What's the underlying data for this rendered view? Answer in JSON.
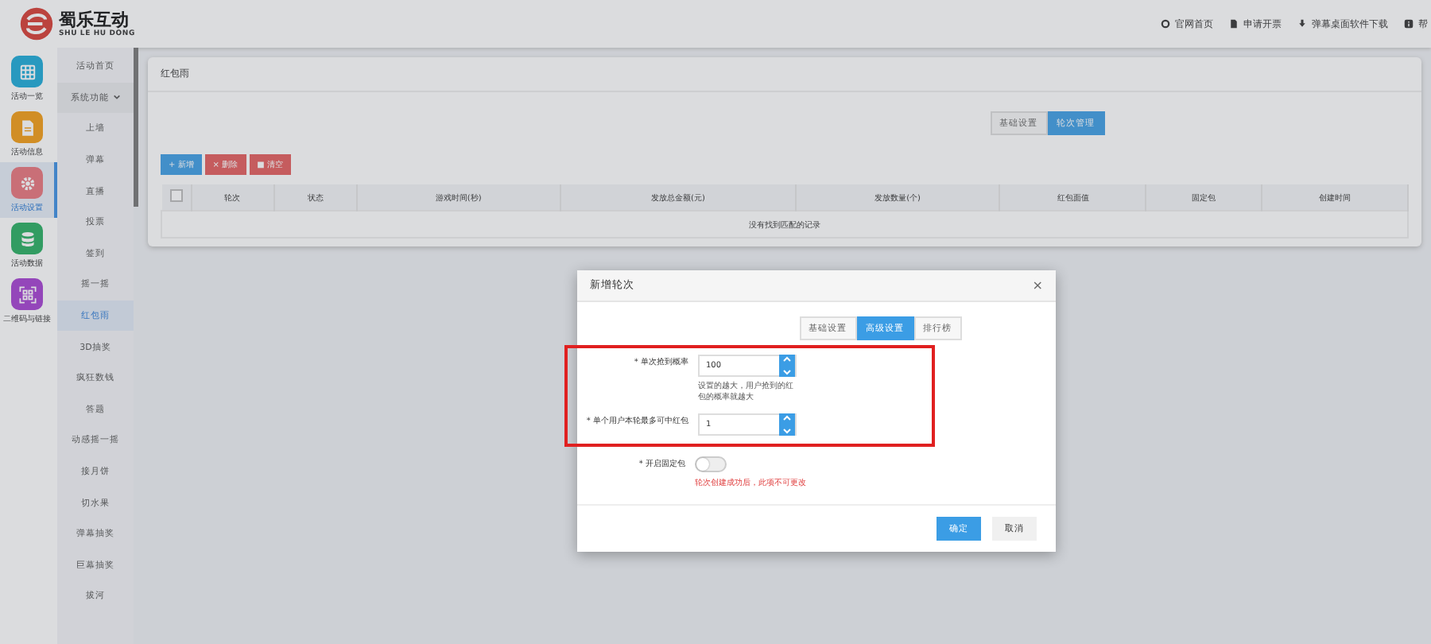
{
  "logo": {
    "name": "蜀乐互动",
    "subtitle": "SHU LE HU DONG"
  },
  "top_links": [
    {
      "label": "官网首页"
    },
    {
      "label": "申请开票"
    },
    {
      "label": "弹幕桌面软件下载"
    },
    {
      "label": "帮"
    }
  ],
  "nav": [
    {
      "label": "活动一览",
      "selected": false
    },
    {
      "label": "活动信息",
      "selected": false
    },
    {
      "label": "活动设置",
      "selected": true
    },
    {
      "label": "活动数据",
      "selected": false
    },
    {
      "label": "二维码与链接",
      "selected": false
    }
  ],
  "subnav": [
    {
      "label": "活动首页",
      "selected": false,
      "expandable": false
    },
    {
      "label": "系统功能",
      "selected": false,
      "expandable": true
    },
    {
      "label": "上墙",
      "selected": false,
      "expandable": false
    },
    {
      "label": "弹幕",
      "selected": false,
      "expandable": false
    },
    {
      "label": "直播",
      "selected": false,
      "expandable": false
    },
    {
      "label": "投票",
      "selected": false,
      "expandable": false
    },
    {
      "label": "签到",
      "selected": false,
      "expandable": false
    },
    {
      "label": "摇一摇",
      "selected": false,
      "expandable": false
    },
    {
      "label": "红包雨",
      "selected": true,
      "expandable": false
    },
    {
      "label": "3D抽奖",
      "selected": false,
      "expandable": false
    },
    {
      "label": "疯狂数钱",
      "selected": false,
      "expandable": false
    },
    {
      "label": "答题",
      "selected": false,
      "expandable": false
    },
    {
      "label": "动感摇一摇",
      "selected": false,
      "expandable": false
    },
    {
      "label": "接月饼",
      "selected": false,
      "expandable": false
    },
    {
      "label": "切水果",
      "selected": false,
      "expandable": false
    },
    {
      "label": "弹幕抽奖",
      "selected": false,
      "expandable": false
    },
    {
      "label": "巨幕抽奖",
      "selected": false,
      "expandable": false
    },
    {
      "label": "拔河",
      "selected": false,
      "expandable": false
    }
  ],
  "panel": {
    "title": "红包雨",
    "tabs": [
      {
        "label": "基础设置",
        "selected": false
      },
      {
        "label": "轮次管理",
        "selected": true
      }
    ],
    "actions": [
      {
        "label": "新增",
        "kind": "add",
        "icon": "+"
      },
      {
        "label": "删除",
        "kind": "danger",
        "icon": "×"
      },
      {
        "label": "清空",
        "kind": "danger",
        "icon": "■"
      }
    ],
    "table": {
      "select_all_checked": false,
      "columns": [
        "轮次",
        "状态",
        "游戏时间(秒)",
        "发放总金额(元)",
        "发放数量(个)",
        "红包面值",
        "固定包",
        "创建时间"
      ],
      "empty_message": "没有找到匹配的记录"
    }
  },
  "dialog": {
    "title": "新增轮次",
    "close": "×",
    "tabs": [
      {
        "label": "基础设置",
        "selected": false
      },
      {
        "label": "高级设置",
        "selected": true
      },
      {
        "label": "排行榜",
        "selected": false
      }
    ],
    "fields": [
      {
        "kind": "number",
        "label": "* 单次抢到概率",
        "value": "100",
        "hint": "设置的越大，用户抢到的红包的概率就越大",
        "highlighted": true
      },
      {
        "kind": "number",
        "label": "* 单个用户本轮最多可中红包",
        "value": "1",
        "highlighted": true
      },
      {
        "kind": "switch",
        "label": "* 开启固定包",
        "on": false,
        "warning": "轮次创建成功后，此项不可更改",
        "highlighted": false
      }
    ],
    "buttons": [
      {
        "label": "确定",
        "primary": true
      },
      {
        "label": "取消",
        "primary": false
      }
    ]
  }
}
